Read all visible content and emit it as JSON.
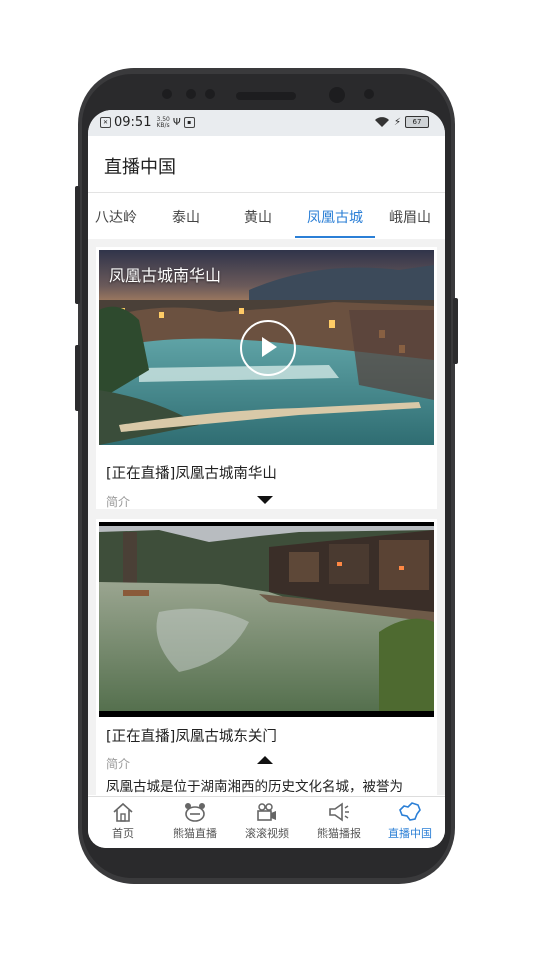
{
  "status_bar": {
    "time": "09:51",
    "net_speed_top": "3.50",
    "net_speed_bottom": "KB/s",
    "battery": "67"
  },
  "appbar": {
    "title": "直播中国"
  },
  "tabs": [
    {
      "label": "八达岭"
    },
    {
      "label": "泰山"
    },
    {
      "label": "黄山"
    },
    {
      "label": "凤凰古城",
      "active": true
    },
    {
      "label": "峨眉山"
    }
  ],
  "cards": [
    {
      "overlay_title": "凤凰古城南华山",
      "title": "[正在直播]凤凰古城南华山",
      "intro_label": "简介",
      "expanded": false
    },
    {
      "overlay_title": "",
      "title": "[正在直播]凤凰古城东关门",
      "intro_label": "简介",
      "expanded": true,
      "description": "凤凰古城是位于湖南湘西的历史文化名城，被誉为"
    }
  ],
  "bottom_nav": [
    {
      "label": "首页",
      "icon": "home-icon"
    },
    {
      "label": "熊猫直播",
      "icon": "panda-icon"
    },
    {
      "label": "滚滚视频",
      "icon": "video-camera-icon"
    },
    {
      "label": "熊猫播报",
      "icon": "megaphone-icon"
    },
    {
      "label": "直播中国",
      "icon": "china-map-icon",
      "active": true
    }
  ],
  "colors": {
    "accent": "#2b7fd6",
    "status_bar_bg": "#e9ecef",
    "feed_bg": "#f2f2f2"
  }
}
